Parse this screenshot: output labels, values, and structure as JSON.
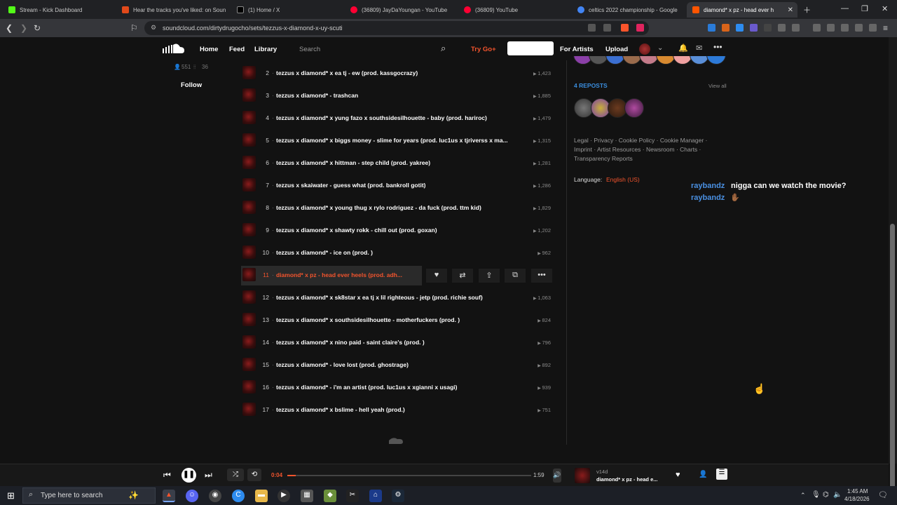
{
  "tabs": [
    {
      "label": "Stream - Kick Dashboard",
      "color": "#53fc18"
    },
    {
      "label": "Hear the tracks you've liked: on Soun",
      "color": "#e1491a"
    },
    {
      "label": "(1) Home / X",
      "color": "#000000"
    },
    {
      "label": "(36809) JayDaYoungan - YouTube",
      "color": "#ff0033"
    },
    {
      "label": "(36809) YouTube",
      "color": "#ff0033"
    },
    {
      "label": "celtics 2022 championship - Google",
      "color": "#4285f4"
    },
    {
      "label": "diamond* x pz - head ever h",
      "color": "#ff5500"
    }
  ],
  "url": "soundcloud.com/dirtydrugocho/sets/tezzus-x-diamond-x-uy-scuti",
  "header": {
    "home": "Home",
    "feed": "Feed",
    "library": "Library",
    "search_placeholder": "Search",
    "try_go": "Try Go+",
    "upgrade": "Upgrade now",
    "for_artists": "For Artists",
    "upload": "Upload"
  },
  "left": {
    "followers": "551",
    "following": "36",
    "follow": "Follow"
  },
  "tracks": [
    {
      "num": "2",
      "title": "tezzus x diamond* x ea tj - ew (prod. kassgocrazy)",
      "plays": "1,423"
    },
    {
      "num": "3",
      "title": "tezzus x diamond* - trashcan",
      "plays": "1,885"
    },
    {
      "num": "4",
      "title": "tezzus x diamond* x yung fazo x southsidesilhouette - baby (prod. hariroc)",
      "plays": "1,479"
    },
    {
      "num": "5",
      "title": "tezzus x diamond* x biggs money - slime for years (prod. luc1us x tjriverss x ma...",
      "plays": "1,315"
    },
    {
      "num": "6",
      "title": "tezzus x diamond* x hittman - step child (prod. yakree)",
      "plays": "1,281"
    },
    {
      "num": "7",
      "title": "tezzus x skaiwater - guess what (prod. bankroll gotit)",
      "plays": "1,286"
    },
    {
      "num": "8",
      "title": "tezzus x diamond* x young thug x rylo rodriguez - da fuck (prod. ttm kid)",
      "plays": "1,829"
    },
    {
      "num": "9",
      "title": "tezzus x diamond* x shawty rokk - chill out (prod. goxan)",
      "plays": "1,202"
    },
    {
      "num": "10",
      "title": "tezzus x diamond* - ice on (prod. )",
      "plays": "962"
    },
    {
      "num": "11",
      "title": "diamond* x pz - head ever heels (prod. adh...",
      "plays": ""
    },
    {
      "num": "12",
      "title": "tezzus x diamond* x sk8star x ea tj x lil righteous - jetp (prod. richie souf)",
      "plays": "1,063"
    },
    {
      "num": "13",
      "title": "tezzus x diamond* x southsidesilhouette - motherfuckers (prod. )",
      "plays": "824"
    },
    {
      "num": "14",
      "title": "tezzus x diamond* x nino paid - saint claire's (prod. )",
      "plays": "796"
    },
    {
      "num": "15",
      "title": "tezzus x diamond* - love lost (prod. ghostrage)",
      "plays": "892"
    },
    {
      "num": "16",
      "title": "tezzus x diamond* - i'm an artist (prod. luc1us x xgianni x usagi)",
      "plays": "939"
    },
    {
      "num": "17",
      "title": "tezzus x diamond* x bslime - hell yeah (prod.)",
      "plays": "751"
    }
  ],
  "right": {
    "reposts": "4 REPOSTS",
    "view_all": "View all",
    "footer_line1": "Legal · Privacy · Cookie Policy · Cookie Manager ·",
    "footer_line2": "Imprint · Artist Resources · Newsroom · Charts ·",
    "footer_line3": "Transparency Reports",
    "language_label": "Language:",
    "language_value": "English (US)"
  },
  "chat": [
    {
      "user": "raybandz",
      "msg": "nigga can we watch the movie?"
    },
    {
      "user": "raybandz",
      "msg": "✋🏾"
    }
  ],
  "player": {
    "elapsed": "0:04",
    "duration": "1:59",
    "progress": 0.034,
    "artist": "v14d",
    "title": "diamond* x pz - head e..."
  },
  "taskbar": {
    "search_placeholder": "Type here to search",
    "time": "1:45 AM",
    "date": "4/18/2026"
  },
  "colors": {
    "accent": "#f2542d",
    "link_blue": "#3a8dde",
    "chat_user": "#4a90e2"
  }
}
